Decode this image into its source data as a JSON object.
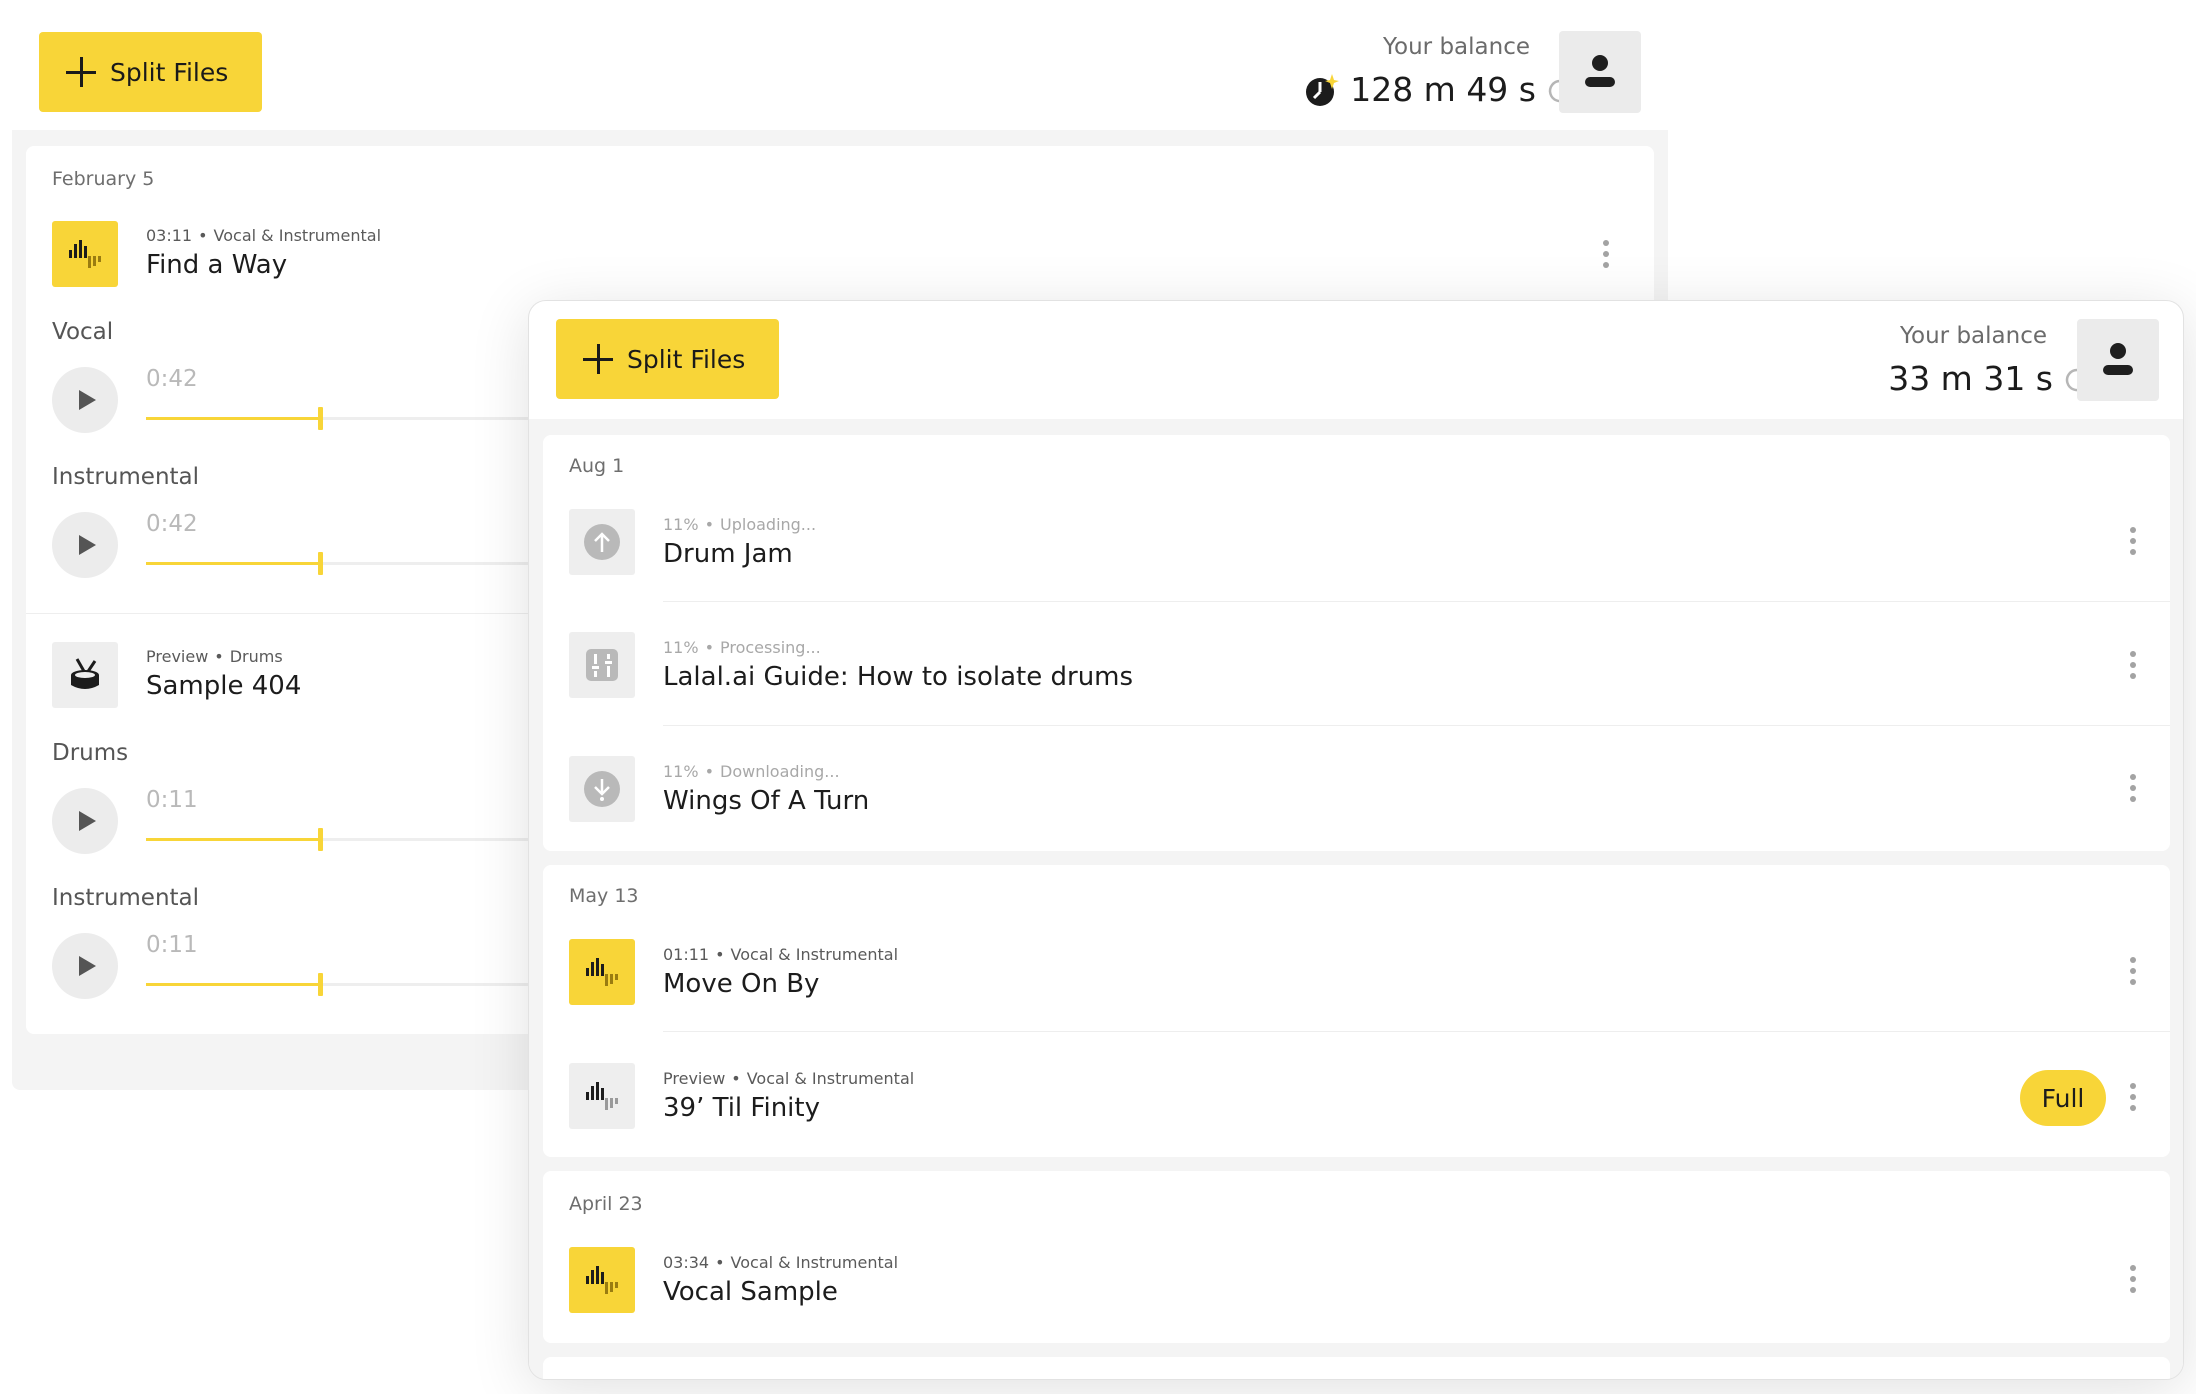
{
  "colors": {
    "accent": "#f8d538",
    "background": "#f4f4f4",
    "card": "#ffffff",
    "text": "#1c1c1c",
    "muted": "#6e6e6e"
  },
  "back_window": {
    "header": {
      "split_button_label": "Split Files",
      "balance_label": "Your balance",
      "balance_value": "128 m 49 s"
    },
    "group": {
      "date": "February 5",
      "tracks": [
        {
          "icon": "waveform-icon",
          "duration": "03:11",
          "stem_type": "Vocal & Instrumental",
          "title": "Find a Way",
          "stems": [
            {
              "label": "Vocal",
              "time": "0:42",
              "progress": 0.43
            },
            {
              "label": "Instrumental",
              "time": "0:42",
              "progress": 0.43
            }
          ]
        },
        {
          "icon": "drum-icon",
          "duration": "Preview",
          "stem_type": "Drums",
          "title": "Sample 404",
          "stems": [
            {
              "label": "Drums",
              "time": "0:11",
              "progress": 0.43
            },
            {
              "label": "Instrumental",
              "time": "0:11",
              "progress": 0.43
            }
          ]
        }
      ]
    }
  },
  "front_window": {
    "header": {
      "split_button_label": "Split Files",
      "balance_label": "Your balance",
      "balance_value": "33 m 31 s"
    },
    "groups": [
      {
        "date": "Aug 1",
        "tracks": [
          {
            "icon": "upload-icon",
            "percent": "11%",
            "status": "Uploading...",
            "title": "Drum Jam"
          },
          {
            "icon": "processing-icon",
            "percent": "11%",
            "status": "Processing...",
            "title": "Lalal.ai Guide: How to isolate drums"
          },
          {
            "icon": "download-icon",
            "percent": "11%",
            "status": "Downloading...",
            "title": "Wings Of A Turn"
          }
        ]
      },
      {
        "date": "May 13",
        "tracks": [
          {
            "icon": "waveform-icon",
            "duration": "01:11",
            "stem_type": "Vocal & Instrumental",
            "title": "Move On By"
          },
          {
            "icon": "waveform-icon",
            "duration": "Preview",
            "stem_type": "Vocal & Instrumental",
            "title": "39’ Til Finity",
            "badge": "Full"
          }
        ]
      },
      {
        "date": "April 23",
        "tracks": [
          {
            "icon": "waveform-icon",
            "duration": "03:34",
            "stem_type": "Vocal & Instrumental",
            "title": "Vocal Sample"
          }
        ]
      }
    ]
  }
}
